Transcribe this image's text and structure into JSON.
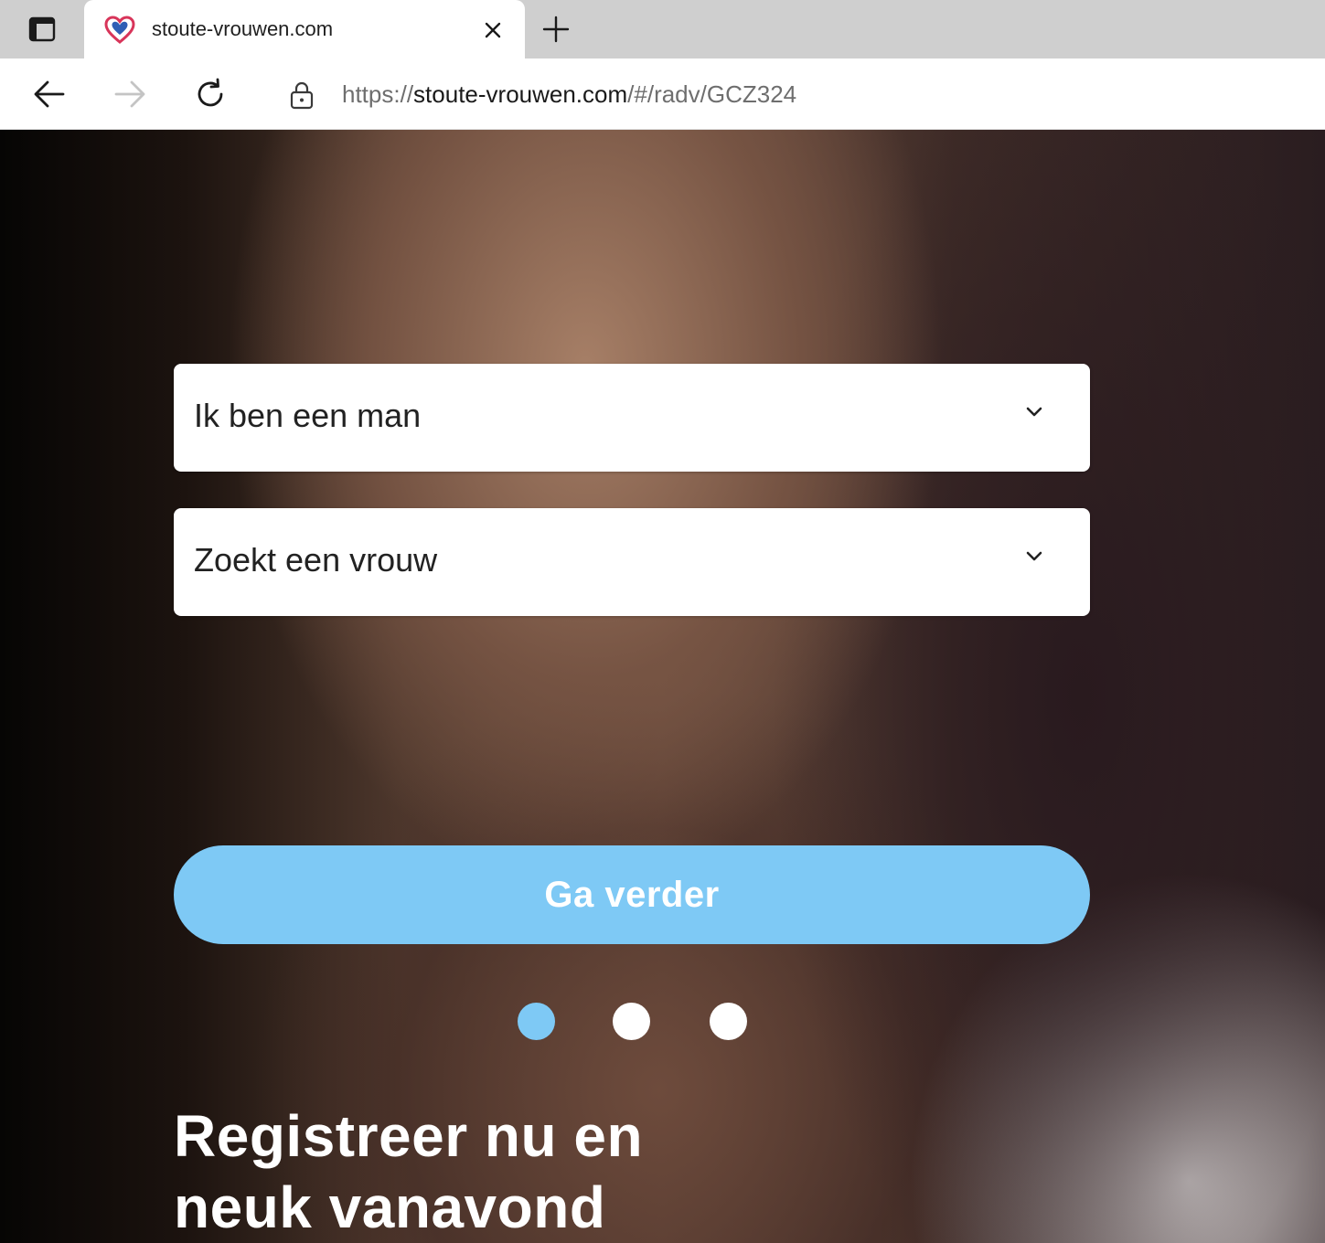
{
  "browser": {
    "tab": {
      "title": "stoute-vrouwen.com",
      "favicon": "heart-icon"
    },
    "address": {
      "scheme": "https://",
      "host": "stoute-vrouwen.com",
      "path": "/#/radv/GCZ324"
    },
    "icons": {
      "tab_actions": "tab-actions-icon",
      "close": "close-icon",
      "new_tab": "plus-icon",
      "back": "arrow-left-icon",
      "forward": "arrow-right-icon",
      "reload": "reload-icon",
      "lock": "lock-icon"
    }
  },
  "form": {
    "gender_select": {
      "value": "Ik ben een man"
    },
    "seeking_select": {
      "value": "Zoekt een vrouw"
    },
    "continue_label": "Ga verder"
  },
  "carousel": {
    "active_index": 0,
    "count": 3
  },
  "headline": {
    "line1": "Registreer nu en",
    "line2": "neuk vanavond"
  },
  "colors": {
    "accent": "#7ec9f5",
    "text_on_accent": "#ffffff",
    "tabstrip": "#cfcfcf"
  }
}
